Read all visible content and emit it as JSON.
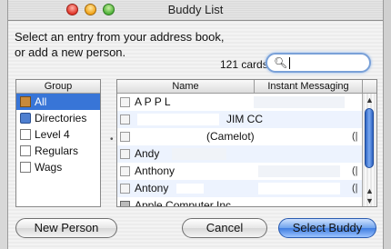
{
  "window": {
    "title": "Buddy List"
  },
  "prompt": {
    "line1": "Select an entry from your address book,",
    "line2": "or add a new person."
  },
  "card_count": "121 cards",
  "search": {
    "value": "",
    "icon": "magnifier-icon"
  },
  "groups": {
    "header": "Group",
    "items": [
      {
        "label": "All",
        "icon": "address-book-icon",
        "selected": true
      },
      {
        "label": "Directories",
        "icon": "directory-icon",
        "selected": false
      },
      {
        "label": "Level 4",
        "icon": "group-icon",
        "selected": false
      },
      {
        "label": "Regulars",
        "icon": "group-icon",
        "selected": false
      },
      {
        "label": "Wags",
        "icon": "group-icon",
        "selected": false
      }
    ]
  },
  "people": {
    "columns": {
      "name": "Name",
      "im": "Instant Messaging"
    },
    "rows": [
      {
        "name": "A P P L",
        "im": ""
      },
      {
        "name": "JIM CC",
        "im": ""
      },
      {
        "name": "(Camelot)",
        "im": "(|"
      },
      {
        "name": "Andy",
        "im": ""
      },
      {
        "name": "Anthony",
        "im": "(|"
      },
      {
        "name": "Antony",
        "im": "(|"
      },
      {
        "name": "Apple Computer Inc",
        "im": ""
      }
    ]
  },
  "buttons": {
    "new_person": "New Person",
    "cancel": "Cancel",
    "select_buddy": "Select Buddy"
  },
  "colors": {
    "selection": "#3875d7",
    "default_button": "#3f7de0"
  }
}
